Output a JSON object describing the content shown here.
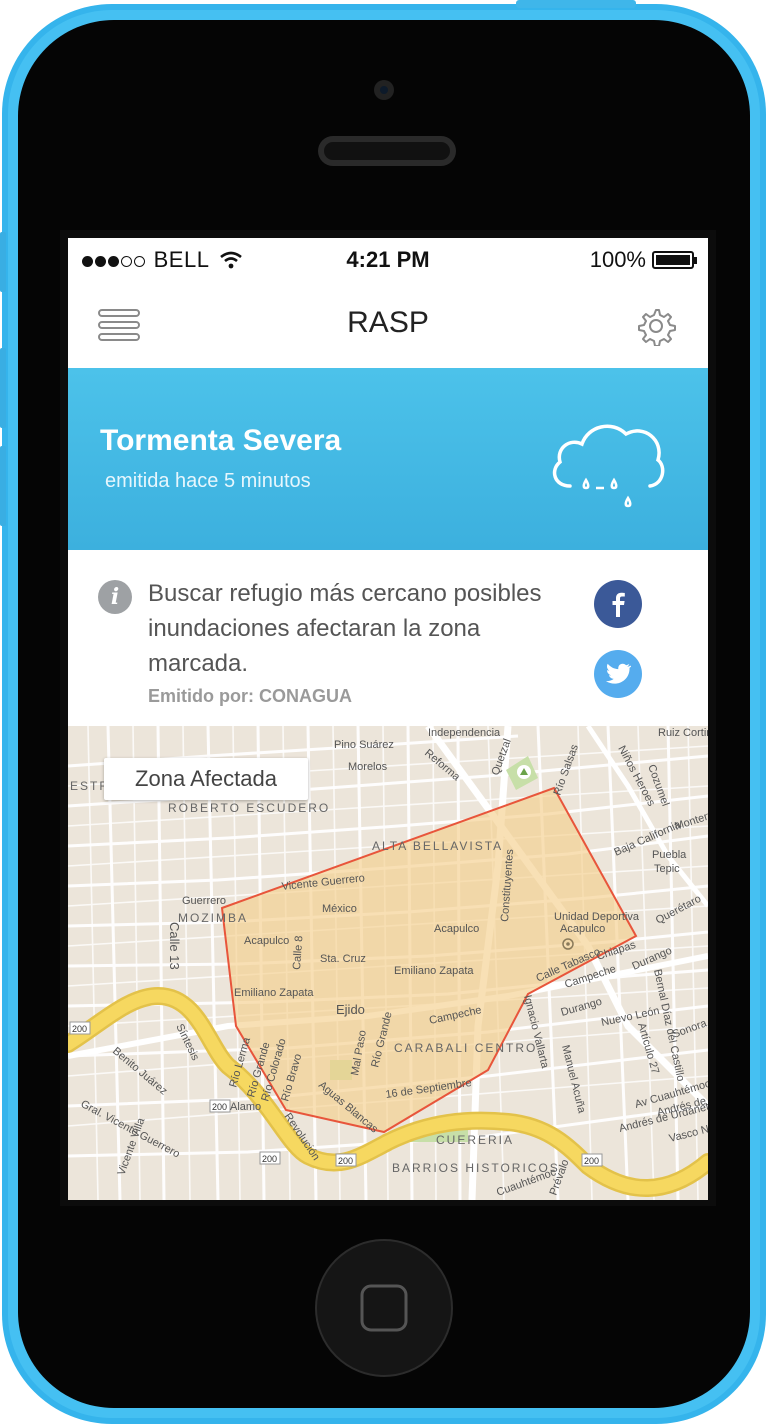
{
  "status_bar": {
    "carrier": "BELL",
    "time": "4:21 PM",
    "battery": "100%",
    "signal_bars_filled": 3,
    "signal_bars_total": 5
  },
  "nav": {
    "title": "RASP",
    "menu_icon": "hamburger-icon",
    "settings_icon": "gear-icon"
  },
  "alert": {
    "title": "Tormenta Severa",
    "subtitle": "emitida hace 5 minutos",
    "icon": "cloud-rain-icon",
    "color": "#45bbe6"
  },
  "info": {
    "icon": "info-icon",
    "message": "Buscar refugio más cercano posibles inundaciones afectaran la zona marcada.",
    "issuer": "Emitido por: CONAGUA",
    "share": [
      "facebook",
      "twitter"
    ]
  },
  "map": {
    "zone_button": "Zona Afectada",
    "labels": {
      "pino_suarez": "Pino Suárez",
      "morelos": "Morelos",
      "independencia": "Independencia",
      "reforma": "Reforma",
      "quetzal": "Quetzal",
      "ninos_heroes": "Niños Heroes",
      "ruiz_cortin": "Ruiz Cortin",
      "cozumel": "Cozumel",
      "estrella_castillo": "ESTR. TILLO",
      "roberto_escudero": "ROBERTO ESCUDERO",
      "alta_bellavista": "ALTA BELLAVISTA",
      "baja_california": "Baja California",
      "monterrey": "Monterrey",
      "puebla": "Puebla",
      "tepic": "Tepic",
      "vicente_guerrero": "Vicente Guerrero",
      "guerrero": "Guerrero",
      "mozimba": "MOZIMBA",
      "mexico": "México",
      "constituyentes": "Constituyentes",
      "acapulco1": "Acapulco",
      "acapulco2": "Acapulco",
      "unidad_deportiva": "Unidad Deportiva",
      "unidad_deportiva_2": "Acapulco",
      "calle13": "Calle 13",
      "calle8": "Calle 8",
      "sta_cruz": "Sta. Cruz",
      "emiliano1": "Emiliano Zapata",
      "emiliano2": "Emiliano Zapata",
      "ejido": "Ejido",
      "campeche1": "Campeche",
      "campeche2": "Campeche",
      "calle_tabasco": "Calle Tabasco",
      "chiapas": "Chiapas",
      "durango1": "Durango",
      "durango2": "Durango",
      "queretaro": "Querétaro",
      "nuevo_leon": "Nuevo León",
      "bernal_diaz": "Bernal Díaz del Castillo",
      "articulo27": "Artículo 27",
      "sonora": "Sonora",
      "carabali": "CARABALI CENTRO",
      "mal_paso": "Mal Paso",
      "rio_grande": "Río Grande",
      "sept16": "16 de Septiembre",
      "ignacio_vallarta": "Ignacio Vallarta",
      "manuel_acuna": "Manuel Acuña",
      "av_cuauhtemoc": "Av Cuauhtémoc",
      "andres_urdaneta1": "Andrés de Urdaneta",
      "andres_urdaneta2": "Andrés de Urdaneta",
      "vasco_nunez": "Vasco Núñez",
      "benito_juarez": "Benito Juárez",
      "gral_vicente": "Gral. Vicente Guerrero",
      "rio_lerma": "Río Lerma",
      "rio_grande2": "Río Grande",
      "rio_colorado": "Río Colorado",
      "rio_bravo": "Río Bravo",
      "aguas_blancas": "Aguas Blancas",
      "alamo": "Alamo",
      "revolucion": "Revolución",
      "cueceria": "CUERERIA",
      "barrios": "BARRIOS HISTORICOS",
      "cuauhtemoc": "Cuauhtémoc",
      "vicente_villa": "Vicente Villa",
      "sintesis": "Síntesis",
      "rio_salsas": "Río Salsas",
      "prevalo": "Prévalo",
      "hwy1": "200",
      "hwy2": "200",
      "hwy3": "200",
      "hwy4": "200",
      "hwy5": "200"
    },
    "colors": {
      "land": "#ece5da",
      "road": "#ffffff",
      "highway": "#f6d860",
      "zone_fill": "#f5cf8e",
      "zone_stroke": "#e8553b"
    }
  }
}
